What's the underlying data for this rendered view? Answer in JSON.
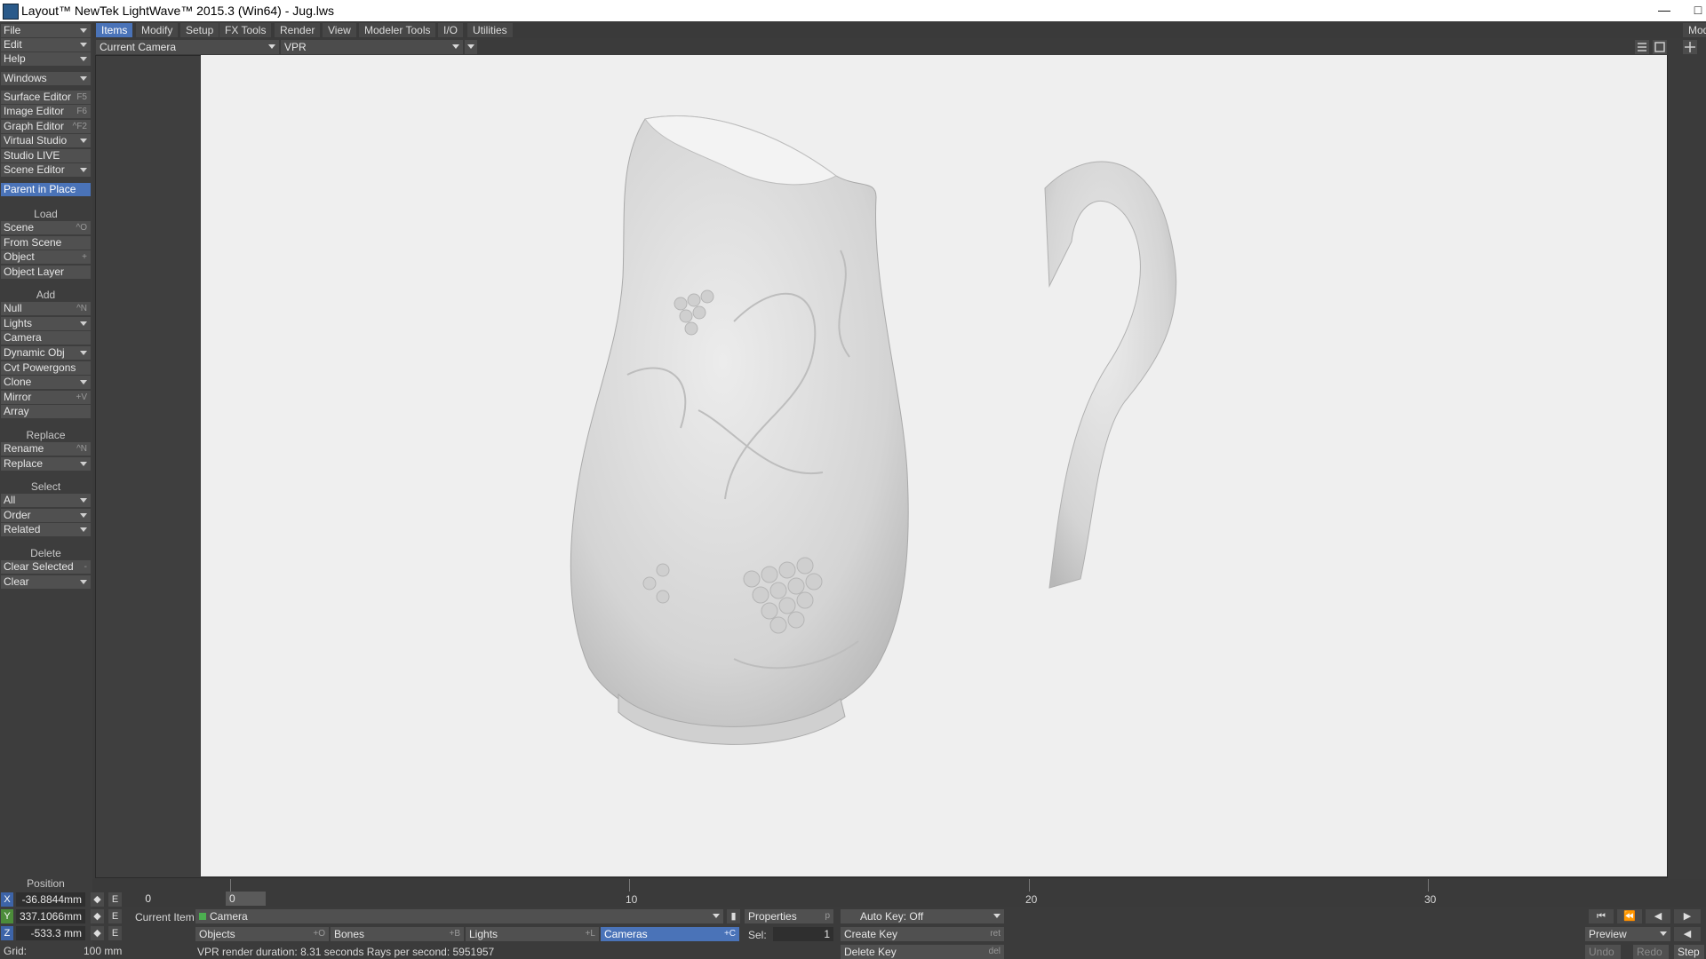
{
  "window": {
    "title": "Layout™ NewTek LightWave™ 2015.3 (Win64) - Jug.lws",
    "minimize_glyph": "—",
    "restore_glyph": "□"
  },
  "left": {
    "top_items": [
      {
        "label": "File",
        "dropdown": true
      },
      {
        "label": "Edit",
        "dropdown": true
      },
      {
        "label": "Help",
        "dropdown": true
      },
      {
        "label": "Windows",
        "dropdown": true
      }
    ],
    "editors": [
      {
        "label": "Surface Editor",
        "shortcut": "F5"
      },
      {
        "label": "Image Editor",
        "shortcut": "F6"
      },
      {
        "label": "Graph Editor",
        "shortcut": "^F2"
      },
      {
        "label": "Virtual Studio",
        "dropdown": true
      },
      {
        "label": "Studio LIVE"
      },
      {
        "label": "Scene Editor",
        "dropdown": true
      }
    ],
    "parent_in_place": "Parent in Place",
    "load_header": "Load",
    "load_items": [
      {
        "label": "Scene",
        "shortcut": "^O"
      },
      {
        "label": "From Scene"
      },
      {
        "label": "Object",
        "shortcut": "+"
      },
      {
        "label": "Object Layer"
      }
    ],
    "add_header": "Add",
    "add_items": [
      {
        "label": "Null",
        "shortcut": "^N"
      },
      {
        "label": "Lights",
        "dropdown": true
      },
      {
        "label": "Camera"
      },
      {
        "label": "Dynamic Obj",
        "dropdown": true
      },
      {
        "label": "Cvt Powergons"
      },
      {
        "label": "Clone",
        "dropdown": true
      },
      {
        "label": "Mirror",
        "shortcut": "+V"
      },
      {
        "label": "Array"
      }
    ],
    "replace_header": "Replace",
    "replace_items": [
      {
        "label": "Rename",
        "shortcut": "^N"
      },
      {
        "label": "Replace",
        "dropdown": true
      }
    ],
    "select_header": "Select",
    "select_items": [
      {
        "label": "All",
        "dropdown": true
      },
      {
        "label": "Order",
        "dropdown": true
      },
      {
        "label": "Related",
        "dropdown": true
      }
    ],
    "delete_header": "Delete",
    "delete_items": [
      {
        "label": "Clear Selected",
        "shortcut": "-"
      },
      {
        "label": "Clear",
        "dropdown": true
      }
    ],
    "position_header": "Position"
  },
  "tabs": [
    "Items",
    "Modify",
    "Setup",
    "FX Tools",
    "Render",
    "View",
    "Modeler Tools",
    "I/O",
    "Utilities"
  ],
  "active_tab": 0,
  "right_tab_clip": "Mod",
  "viewport": {
    "view_select": "Current Camera",
    "render_mode": "VPR"
  },
  "timeline": {
    "ticks": [
      {
        "value": "0"
      },
      {
        "value": "10"
      },
      {
        "value": "20"
      },
      {
        "value": "30"
      }
    ],
    "current_frame": "0"
  },
  "bottom": {
    "x_label": "X",
    "y_label": "Y",
    "z_label": "Z",
    "x_value": "-36.8844mm",
    "y_value": "337.1066mm",
    "z_value": "-533.3 mm",
    "e": "E",
    "frame_field": "0",
    "current_item_label": "Current Item",
    "current_item": "Camera",
    "properties": "Properties",
    "properties_shortcut": "p",
    "auto_key": "Auto Key: Off",
    "objects": "Objects",
    "objects_sc": "+O",
    "bones": "Bones",
    "bones_sc": "+B",
    "lights": "Lights",
    "lights_sc": "+L",
    "cameras": "Cameras",
    "cameras_sc": "+C",
    "sel_label": "Sel:",
    "sel_value": "1",
    "create_key": "Create Key",
    "create_key_sc": "ret",
    "delete_key": "Delete Key",
    "delete_key_sc": "del",
    "grid_label": "Grid:",
    "grid_value": "100 mm",
    "status": "VPR render duration: 8.31 seconds  Rays per second: 5951957",
    "preview": "Preview",
    "undo": "Undo",
    "redo": "Redo",
    "step": "Step"
  },
  "colors": {
    "accent": "#4a73b8",
    "panel": "#3d3d3d",
    "render_bg": "#efefef",
    "jug": "#d9d9d9"
  }
}
